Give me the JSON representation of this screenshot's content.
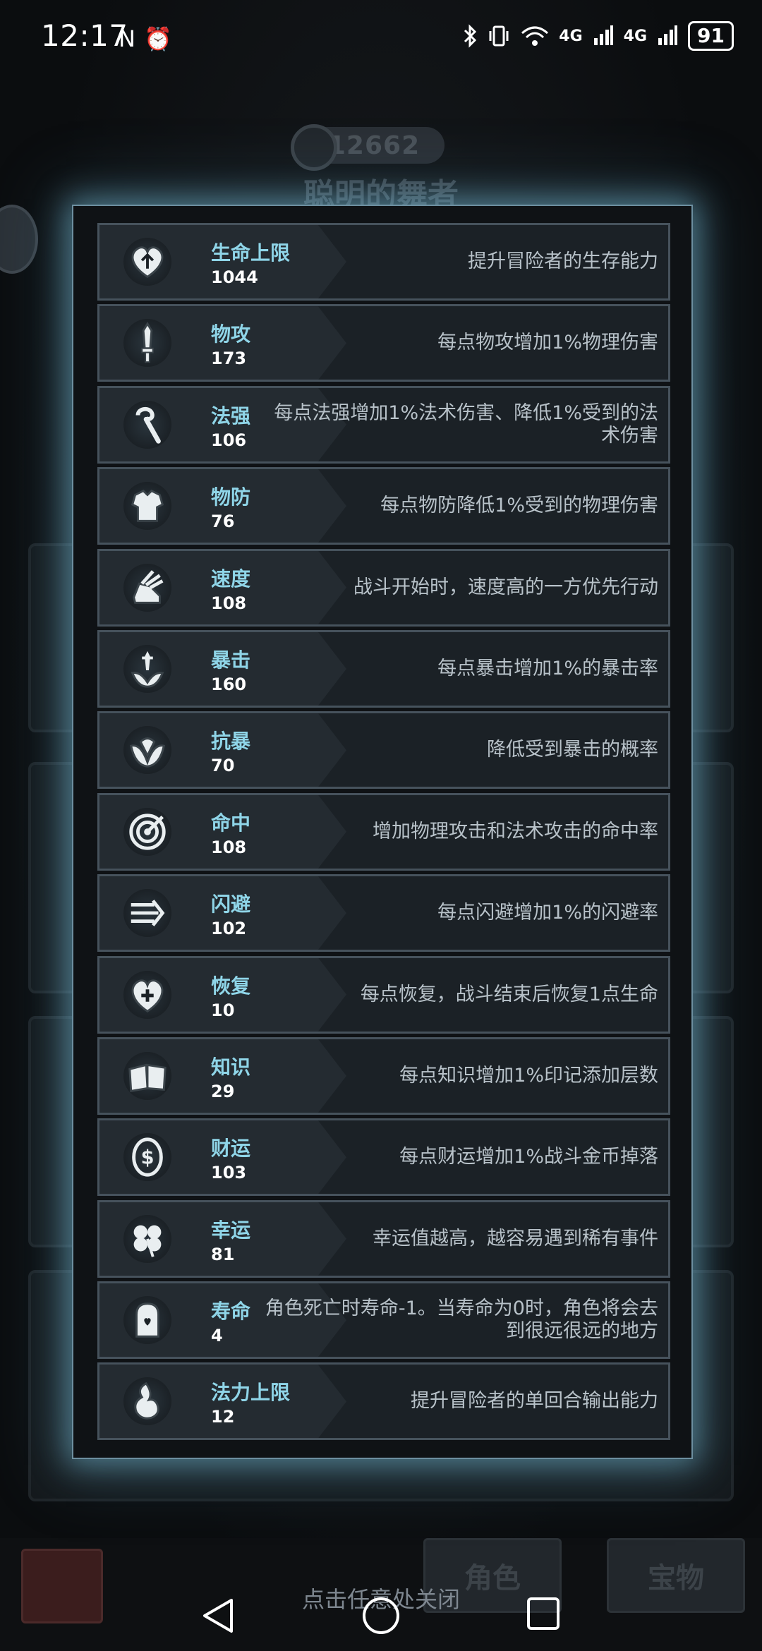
{
  "status_bar": {
    "time": "12:17",
    "left_icons": [
      "N",
      "⏰"
    ],
    "right_icons": [
      "bluetooth-icon",
      "vibrate-icon",
      "wifi-icon",
      "4G",
      "4G"
    ],
    "battery": "91"
  },
  "background": {
    "score": "12662",
    "character_name": "聪明的舞者",
    "tab_role": "角色",
    "tab_treasure": "宝物"
  },
  "stats": [
    {
      "icon": "heart-arrow-icon",
      "name": "生命上限",
      "value": "1044",
      "desc": "提升冒险者的生存能力"
    },
    {
      "icon": "sword-icon",
      "name": "物攻",
      "value": "173",
      "desc": "每点物攻增加1%物理伤害"
    },
    {
      "icon": "staff-icon",
      "name": "法强",
      "value": "106",
      "desc": "每点法强增加1%法术伤害、降低1%受到的法术伤害"
    },
    {
      "icon": "armor-icon",
      "name": "物防",
      "value": "76",
      "desc": "每点物防降低1%受到的物理伤害"
    },
    {
      "icon": "winged-boot-icon",
      "name": "速度",
      "value": "108",
      "desc": "战斗开始时，速度高的一方优先行动"
    },
    {
      "icon": "critical-strike-icon",
      "name": "暴击",
      "value": "160",
      "desc": "每点暴击增加1%的暴击率"
    },
    {
      "icon": "crit-resist-icon",
      "name": "抗暴",
      "value": "70",
      "desc": "降低受到暴击的概率"
    },
    {
      "icon": "target-icon",
      "name": "命中",
      "value": "108",
      "desc": "增加物理攻击和法术攻击的命中率"
    },
    {
      "icon": "dodge-arrows-icon",
      "name": "闪避",
      "value": "102",
      "desc": "每点闪避增加1%的闪避率"
    },
    {
      "icon": "heart-plus-icon",
      "name": "恢复",
      "value": "10",
      "desc": "每点恢复，战斗结束后恢复1点生命"
    },
    {
      "icon": "book-icon",
      "name": "知识",
      "value": "29",
      "desc": "每点知识增加1%印记添加层数"
    },
    {
      "icon": "coin-icon",
      "name": "财运",
      "value": "103",
      "desc": "每点财运增加1%战斗金币掉落"
    },
    {
      "icon": "clover-icon",
      "name": "幸运",
      "value": "81",
      "desc": "幸运值越高，越容易遇到稀有事件"
    },
    {
      "icon": "tombstone-icon",
      "name": "寿命",
      "value": "4",
      "desc": "角色死亡时寿命-1。当寿命为0时，角色将会去到很远很远的地方"
    },
    {
      "icon": "mana-drop-icon",
      "name": "法力上限",
      "value": "12",
      "desc": "提升冒险者的单回合输出能力"
    }
  ],
  "close_hint": "点击任意处关闭",
  "nav": {
    "back": "back-icon",
    "home": "home-icon",
    "recents": "recents-icon"
  }
}
